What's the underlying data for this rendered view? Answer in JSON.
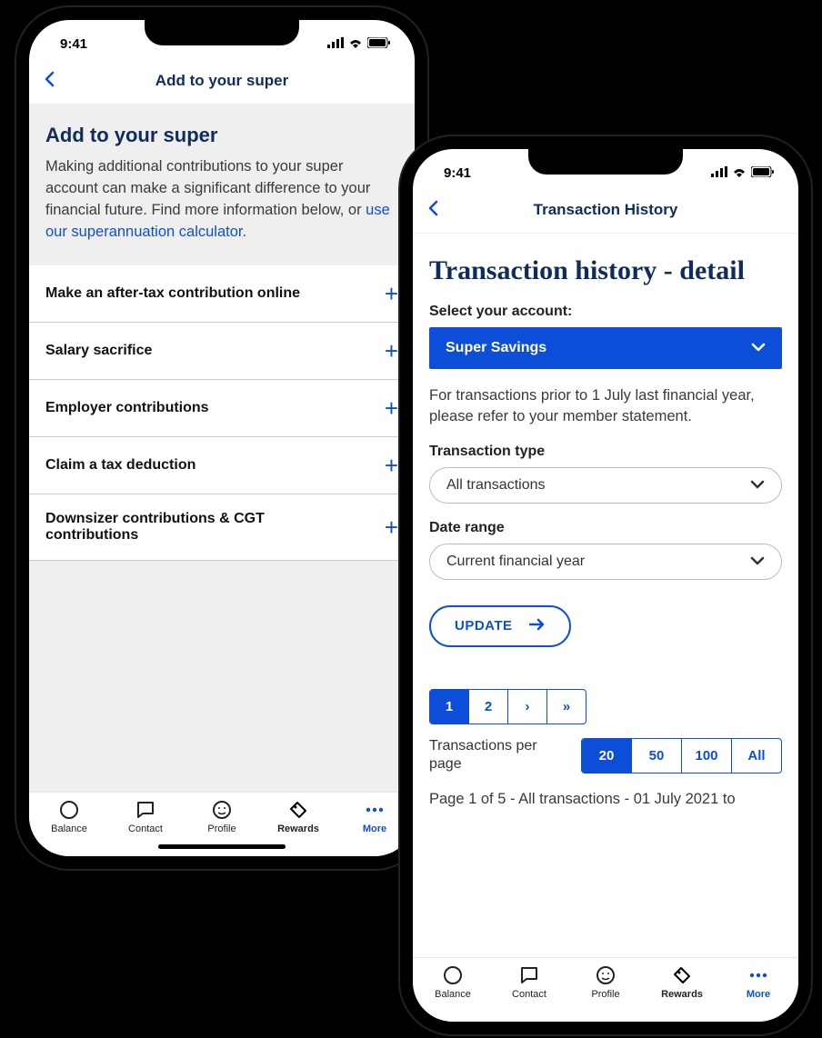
{
  "status": {
    "time": "9:41"
  },
  "colors": {
    "primary": "#0d4ed9",
    "heading": "#0f2c5c"
  },
  "left": {
    "nav_title": "Add to your super",
    "heading": "Add to your super",
    "body_text": "Making additional contributions to your super account can make a significant difference to your financial future. Find more information below, or ",
    "link_text": "use our superannuation calculator.",
    "accordion": [
      "Make an after-tax contribution online",
      "Salary sacrifice",
      "Employer contributions",
      "Claim a tax deduction",
      "Downsizer contributions & CGT contributions"
    ]
  },
  "right": {
    "nav_title": "Transaction History",
    "heading": "Transaction history - detail",
    "select_account_label": "Select your account:",
    "account_selected": "Super Savings",
    "helper": "For transactions prior to 1 July last financial year, please refer to your member statement.",
    "txn_type_label": "Transaction type",
    "txn_type_value": "All transactions",
    "date_range_label": "Date range",
    "date_range_value": "Current financial year",
    "update_label": "UPDATE",
    "pager": {
      "pages": [
        "1",
        "2",
        "›",
        "»"
      ],
      "active": "1"
    },
    "perpage_label": "Transactions per page",
    "perpage_options": [
      "20",
      "50",
      "100",
      "All"
    ],
    "perpage_active": "20",
    "summary": "Page 1 of 5 - All transactions - 01 July 2021 to"
  },
  "tabs": [
    {
      "id": "balance",
      "label": "Balance",
      "icon": "circle-icon"
    },
    {
      "id": "contact",
      "label": "Contact",
      "icon": "chat-icon"
    },
    {
      "id": "profile",
      "label": "Profile",
      "icon": "face-icon"
    },
    {
      "id": "rewards",
      "label": "Rewards",
      "icon": "tag-icon"
    },
    {
      "id": "more",
      "label": "More",
      "icon": "dots-icon"
    }
  ]
}
